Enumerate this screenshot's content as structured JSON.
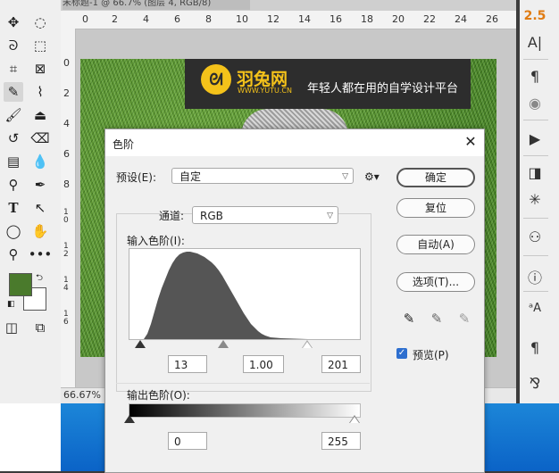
{
  "document": {
    "tab_title": "未标题-1 @ 66.7% (图层 4, RGB/8)",
    "zoom": "66.67%",
    "ruler_h": [
      "0",
      "2",
      "4",
      "6",
      "8",
      "10",
      "12",
      "14",
      "16",
      "18",
      "20",
      "22",
      "24",
      "26"
    ],
    "ruler_v": [
      "0",
      "2",
      "4",
      "6",
      "8",
      "1 0",
      "1 2",
      "1 4",
      "1 6"
    ]
  },
  "banner": {
    "brand": "羽兔网",
    "url": "WWW.YUTU.CN",
    "slogan": "年轻人都在用的自学设计平台"
  },
  "right_panel": {
    "font_size_value": "2.5"
  },
  "levels_dialog": {
    "title": "色阶",
    "preset_label": "预设(E):",
    "preset_value": "自定",
    "channel_label": "通道:",
    "channel_value": "RGB",
    "input_levels_label": "输入色阶(I):",
    "input_black": "13",
    "input_gamma": "1.00",
    "input_white": "201",
    "output_levels_label": "输出色阶(O):",
    "output_black": "0",
    "output_white": "255",
    "buttons": {
      "ok": "确定",
      "reset": "复位",
      "auto": "自动(A)",
      "options": "选项(T)..."
    },
    "preview_label": "预览(P)",
    "preview_checked": true
  },
  "colors": {
    "foreground": "#4a7a2c",
    "background": "#ffffff",
    "banner_accent": "#f4c21a",
    "checkbox": "#2e6fcf"
  },
  "icons": {
    "toolbar": [
      "move-icon",
      "marquee-icon",
      "lasso-icon",
      "object-select-icon",
      "crop-icon",
      "frame-icon",
      "eyedropper-icon",
      "healing-brush-icon",
      "brush-icon",
      "stamp-icon",
      "history-brush-icon",
      "eraser-icon",
      "gradient-icon",
      "blur-icon",
      "dodge-icon",
      "pen-icon",
      "type-icon",
      "path-select-icon",
      "shape-icon",
      "hand-icon",
      "zoom-icon",
      "more-tools-icon"
    ]
  }
}
